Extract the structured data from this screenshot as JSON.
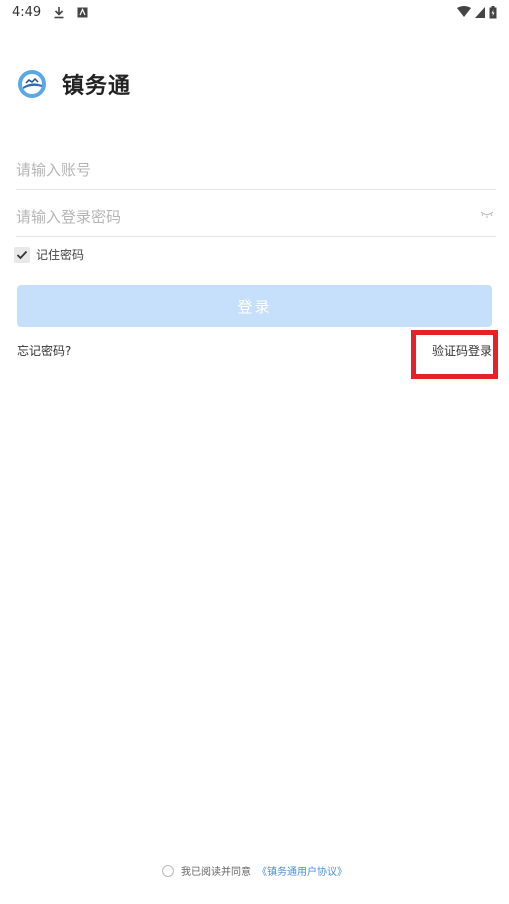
{
  "status_bar": {
    "time": "4:49",
    "icons": [
      "download-icon",
      "accessibility-icon",
      "wifi-icon",
      "signal-icon",
      "battery-icon"
    ]
  },
  "header": {
    "app_name": "镇务通",
    "logo_icon": "app-logo-icon"
  },
  "form": {
    "account_placeholder": "请输入账号",
    "account_value": "",
    "password_placeholder": "请输入登录密码",
    "password_value": "",
    "remember_label": "记住密码",
    "remember_checked": true,
    "login_label": "登录"
  },
  "links": {
    "forgot_password": "忘记密码?",
    "sms_login": "验证码登录"
  },
  "agreement": {
    "text": "我已阅读并同意",
    "link": "《镇务通用户协议》",
    "checked": false
  },
  "colors": {
    "login_button_bg": "#c6dffb",
    "link": "#4a90d9",
    "highlight": "#e8202a"
  }
}
